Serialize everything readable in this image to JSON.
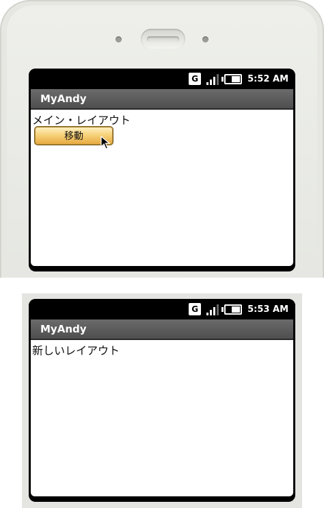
{
  "screens": [
    {
      "status": {
        "clock": "5:52 AM",
        "network_label": "G"
      },
      "app_title": "MyAndy",
      "content_text": "メイン・レイアウト",
      "button_label": "移動"
    },
    {
      "status": {
        "clock": "5:53 AM",
        "network_label": "G"
      },
      "app_title": "MyAndy",
      "content_text": "新しいレイアウト"
    }
  ],
  "colors": {
    "title_bar": "#5c5c5c",
    "button_gradient_top": "#fff3c7",
    "button_gradient_bottom": "#e6a83d",
    "phone_body": "#e6e7e2"
  }
}
